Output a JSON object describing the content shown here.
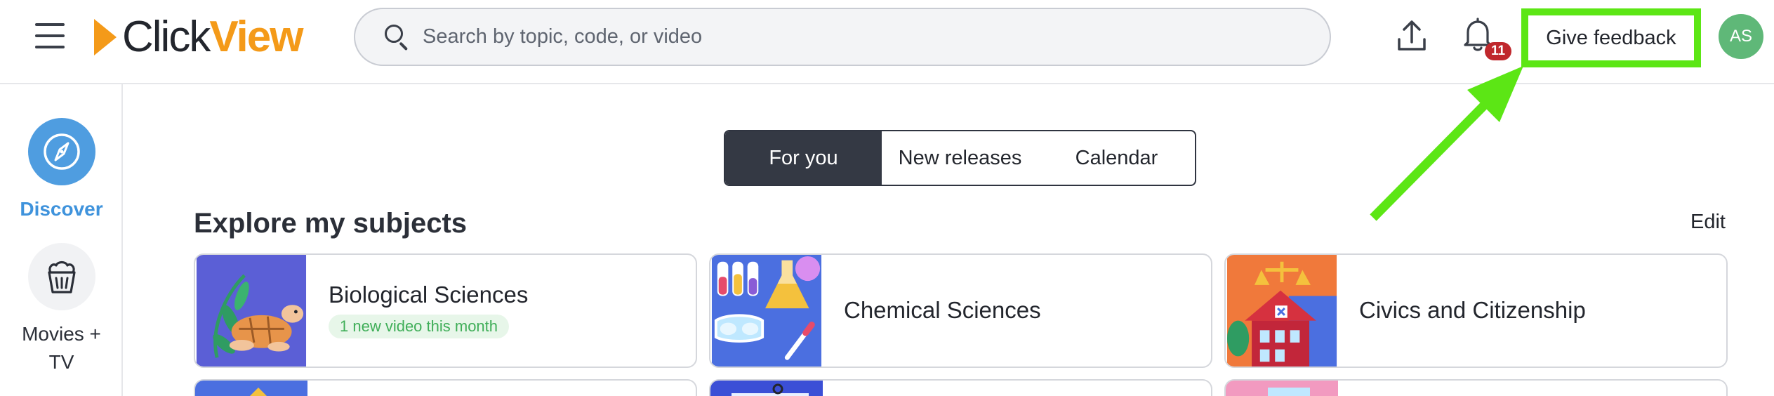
{
  "header": {
    "logo": {
      "left": "Click",
      "right": "View"
    },
    "search": {
      "placeholder": "Search by topic, code, or video",
      "value": ""
    },
    "notifications": {
      "count": "11"
    },
    "feedback_label": "Give feedback",
    "avatar_initials": "AS"
  },
  "sidebar": {
    "items": [
      {
        "label": "Discover",
        "icon": "compass-icon",
        "active": true
      },
      {
        "label": "Movies + TV",
        "icon": "popcorn-icon",
        "active": false
      }
    ]
  },
  "tabs": [
    {
      "label": "For you",
      "active": true
    },
    {
      "label": "New releases",
      "active": false
    },
    {
      "label": "Calendar",
      "active": false
    }
  ],
  "subjects": {
    "title": "Explore my subjects",
    "edit_label": "Edit",
    "cards": [
      {
        "title": "Biological Sciences",
        "badge": "1 new video this month"
      },
      {
        "title": "Chemical Sciences"
      },
      {
        "title": "Civics and Citizenship"
      }
    ]
  },
  "colors": {
    "brand_orange": "#f49a19",
    "accent_blue": "#4f9de0",
    "highlight_green": "#5ce615",
    "badge_red": "#c0282d",
    "tab_active": "#343944"
  }
}
